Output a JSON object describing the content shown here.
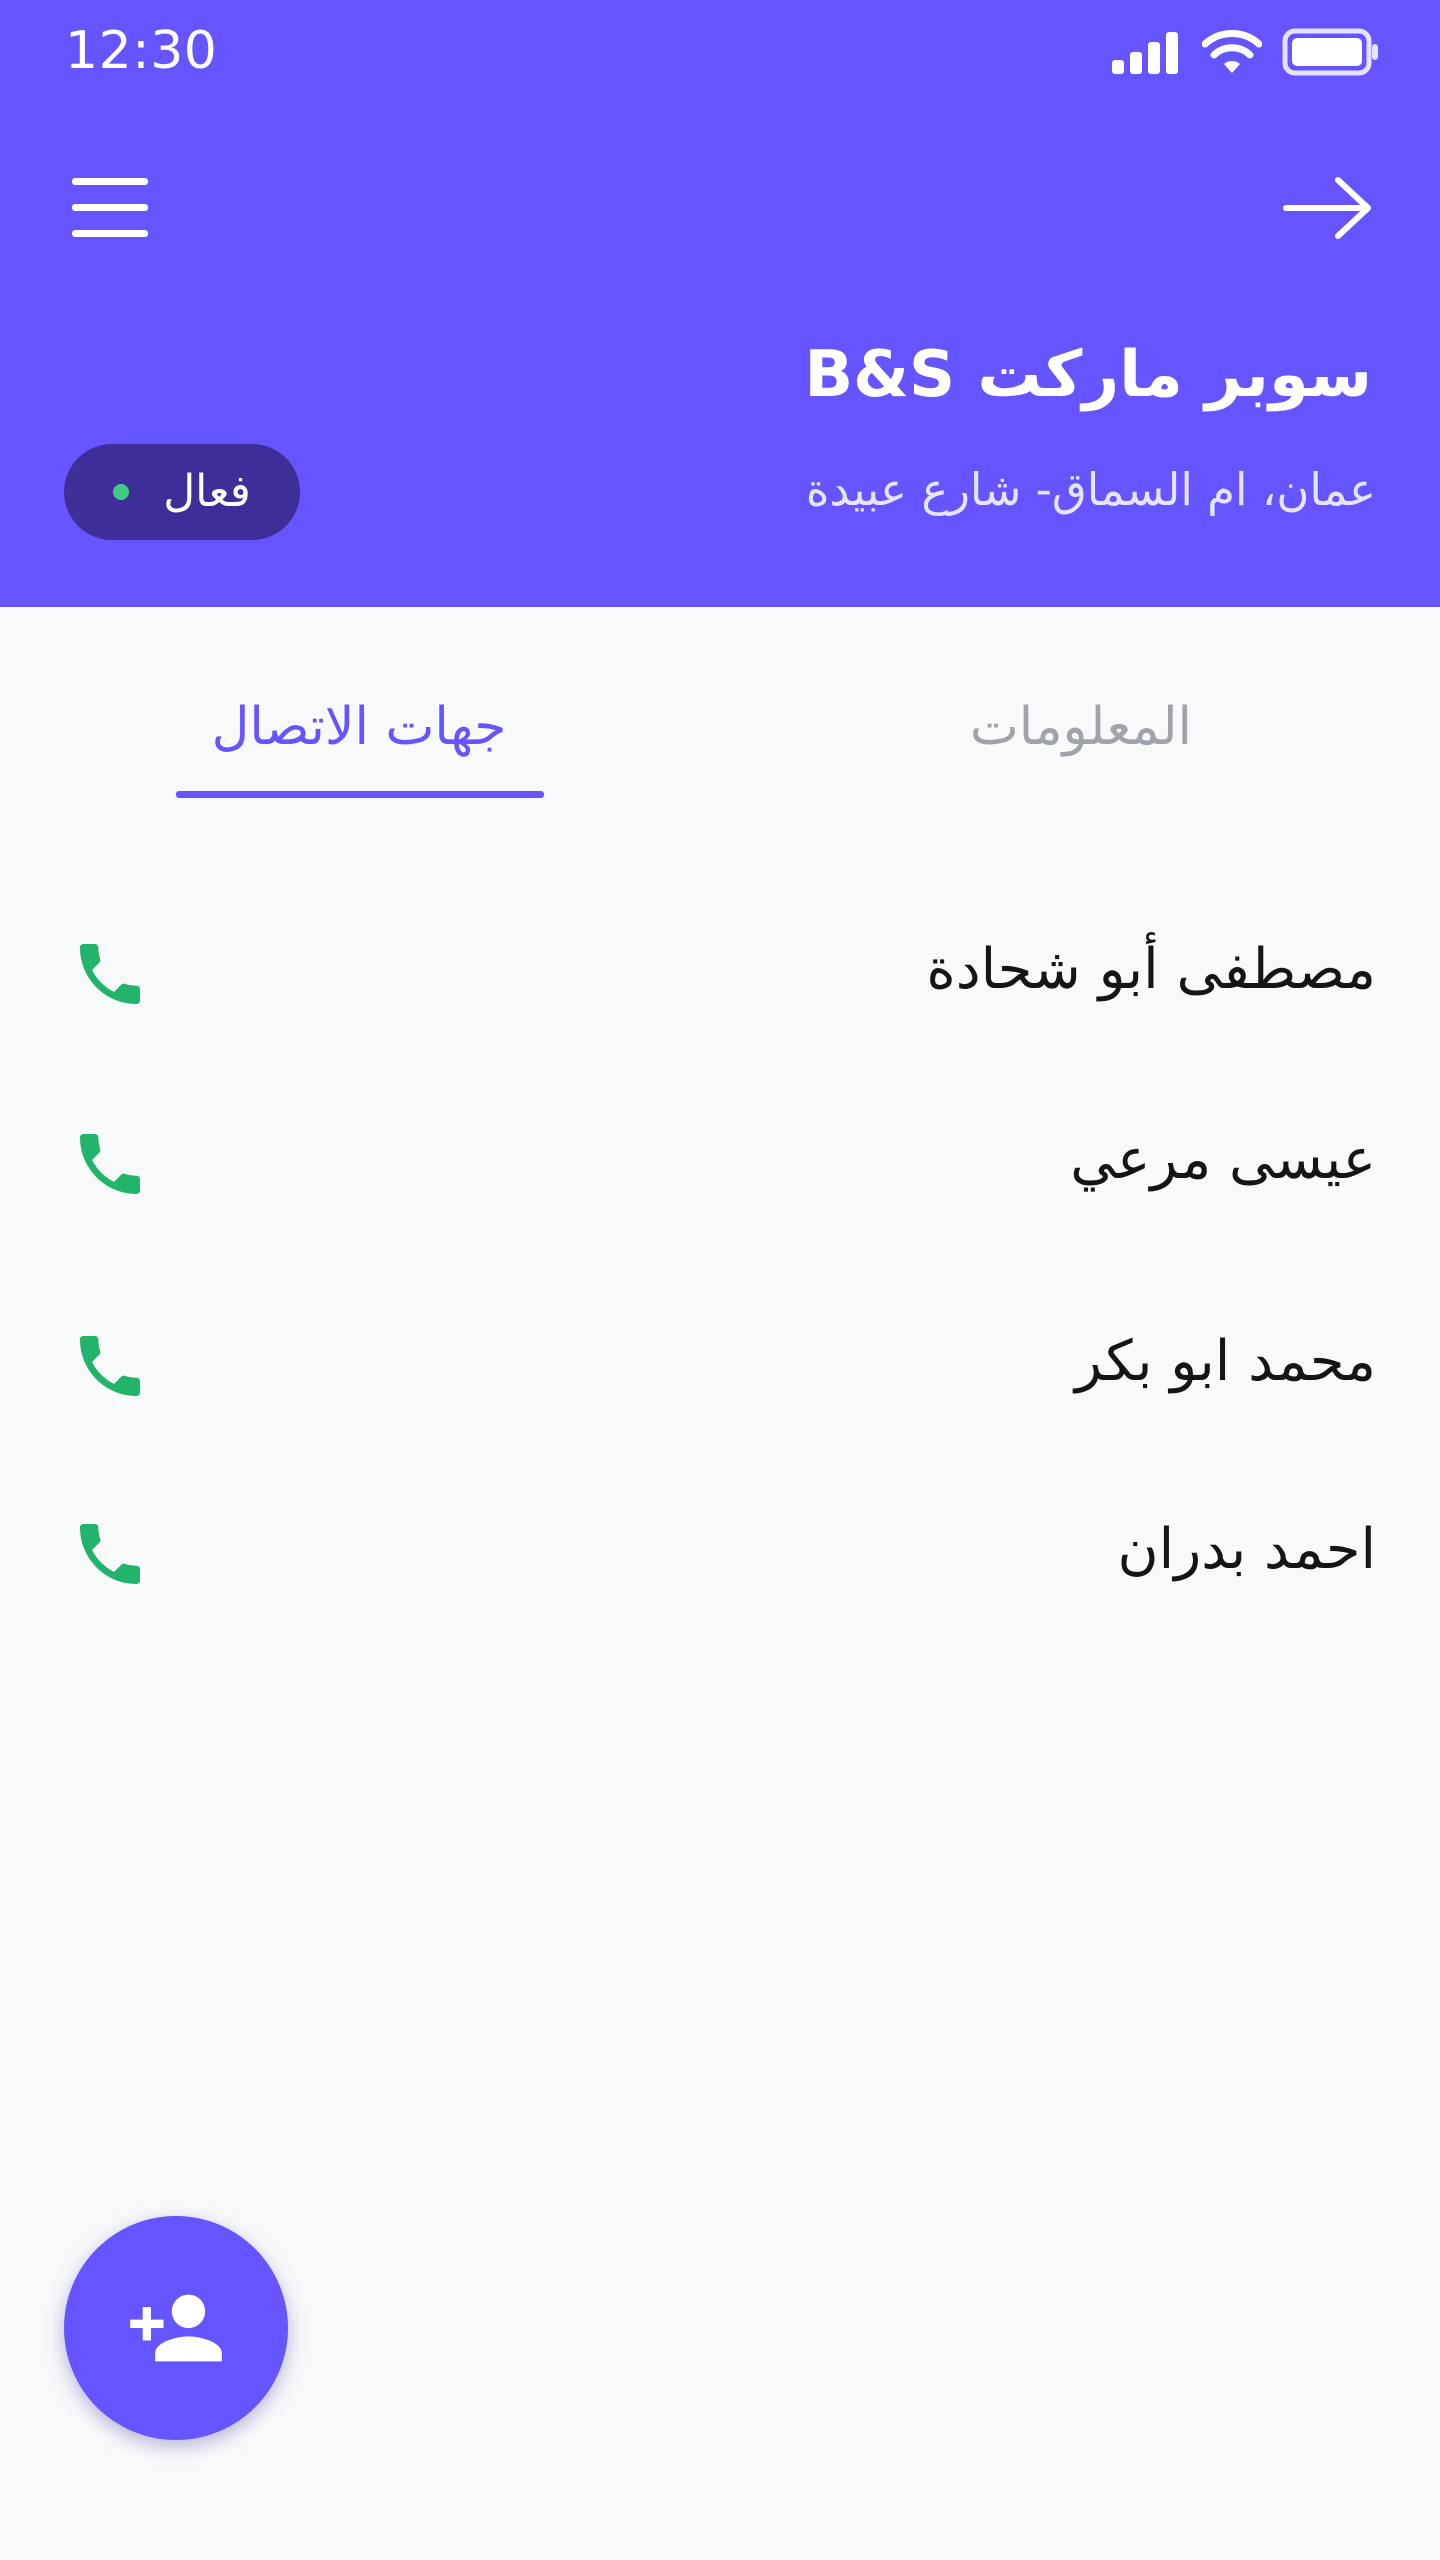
{
  "status_bar": {
    "time": "12:30",
    "icons": [
      "signal-icon",
      "wifi-icon",
      "battery-icon"
    ]
  },
  "header": {
    "menu_icon": "menu-icon",
    "back_icon": "arrow-right-icon",
    "store_name": "سوبر ماركت B&S",
    "address": "عمان، ام السماق- شارع عبيدة",
    "status_label": "فعال",
    "background_color": "#6655ff",
    "status_dot_color": "#3fca83"
  },
  "tabs": [
    {
      "label": "المعلومات",
      "active": false
    },
    {
      "label": "جهات الاتصال",
      "active": true
    }
  ],
  "contacts": [
    {
      "name": "مصطفى أبو شحادة",
      "icon": "phone-icon"
    },
    {
      "name": "عيسى مرعي",
      "icon": "phone-icon"
    },
    {
      "name": "محمد ابو بكر",
      "icon": "phone-icon"
    },
    {
      "name": "احمد بدران",
      "icon": "phone-icon"
    }
  ],
  "fab": {
    "icon": "add-person-icon"
  },
  "colors": {
    "accent": "#6655ff",
    "phone": "#22b46a",
    "background": "#f8f9fb"
  }
}
